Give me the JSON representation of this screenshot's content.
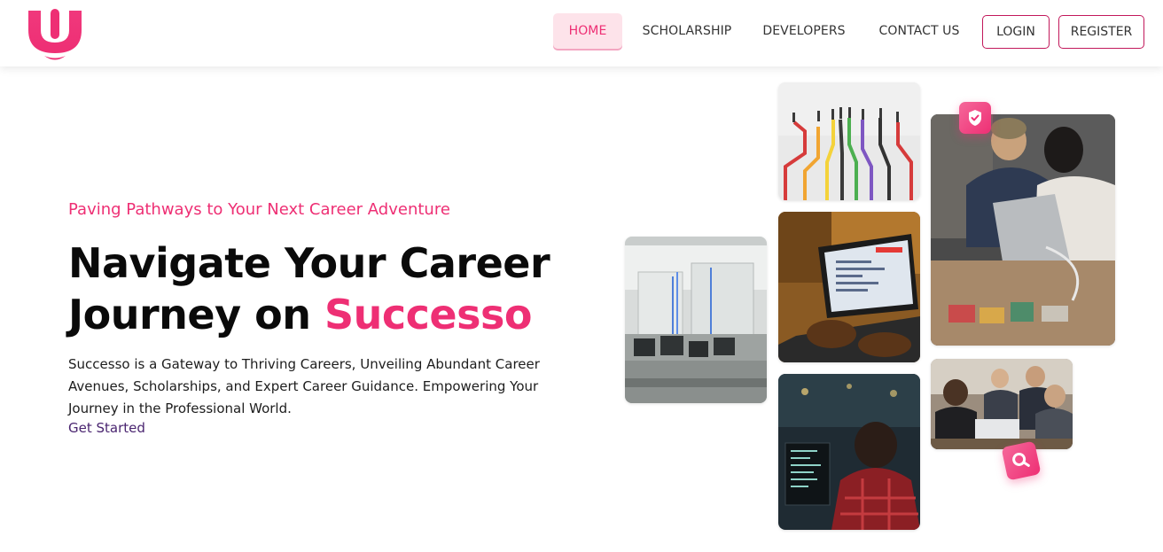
{
  "header": {
    "logo_alt": "Successo logo",
    "nav": {
      "home": "HOME",
      "scholarship": "SCHOLARSHIP",
      "developers": "DEVELOPERS",
      "contact": "CONTACT US",
      "login": "LOGIN",
      "register": "REGISTER"
    }
  },
  "hero": {
    "tagline": "Paving Pathways to Your Next Career Adventure",
    "headline_part1": "Navigate Your Career Journey on ",
    "headline_accent": "Successo",
    "description": "Successo is a Gateway to Thriving Careers, Unveiling Abundant Career Avenues, Scholarships, and Expert Career Guidance. Empowering Your Journey in the Professional World.",
    "cta": "Get Started"
  },
  "gallery": {
    "items": [
      "office-photo",
      "career-paths-photo",
      "laptop-coding-photo",
      "developer-monitors-photo",
      "meeting-photo",
      "team-photo"
    ],
    "badges": [
      "shield-check-icon",
      "search-icon"
    ]
  },
  "colors": {
    "accent": "#ee2f74",
    "accent_light": "#fde3ea",
    "link": "#4a2570",
    "button_border": "#c2185b"
  }
}
